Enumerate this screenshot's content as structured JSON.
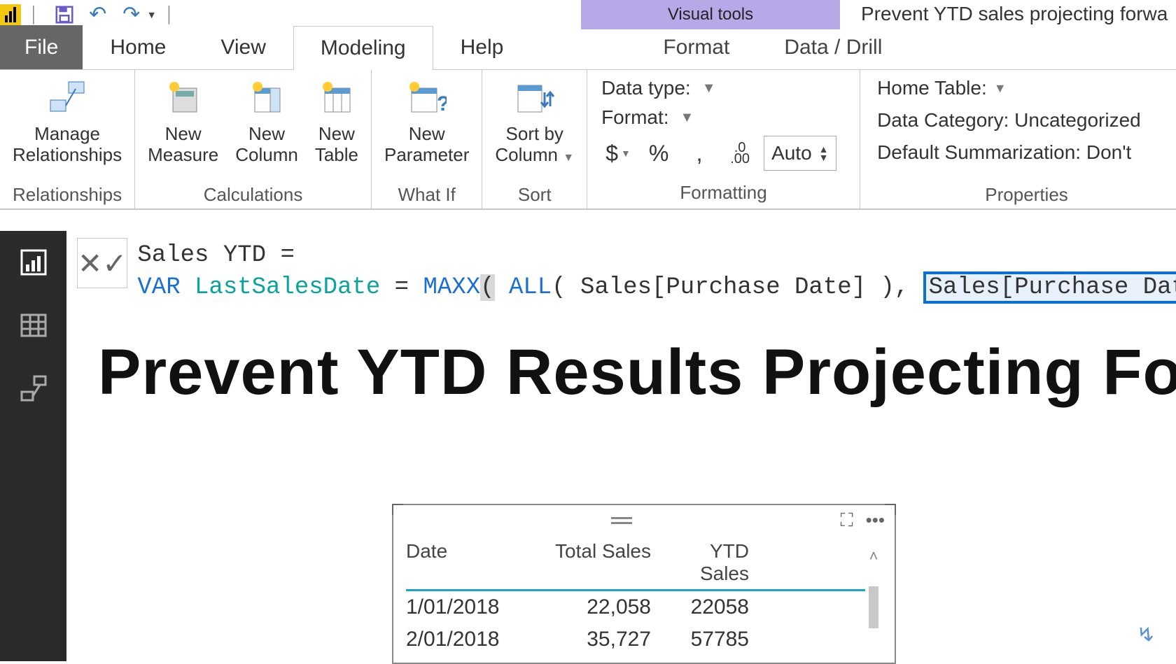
{
  "qat": {
    "visual_tools": "Visual tools",
    "window_title": "Prevent YTD sales projecting forwa"
  },
  "tabs": {
    "file": "File",
    "home": "Home",
    "view": "View",
    "modeling": "Modeling",
    "help": "Help",
    "format": "Format",
    "data_drill": "Data / Drill"
  },
  "ribbon": {
    "relationships": {
      "manage": "Manage\nRelationships",
      "group": "Relationships"
    },
    "calculations": {
      "measure": "New\nMeasure",
      "column": "New\nColumn",
      "table": "New\nTable",
      "group": "Calculations"
    },
    "whatif": {
      "parameter": "New\nParameter",
      "group": "What If"
    },
    "sort": {
      "sortby": "Sort by\nColumn",
      "group": "Sort"
    },
    "formatting": {
      "datatype": "Data type:",
      "format": "Format:",
      "dollar": "$",
      "percent": "%",
      "comma": ",",
      "decimals_icon": ".00",
      "auto": "Auto",
      "group": "Formatting"
    },
    "properties": {
      "home_table": "Home Table:",
      "category": "Data Category: Uncategorized",
      "summarization": "Default Summarization: Don't",
      "group": "Properties"
    }
  },
  "formula": {
    "line1": "Sales YTD =",
    "var_kw": "VAR",
    "var_name": "LastSalesDate",
    "eq": " = ",
    "maxx": "MAXX",
    "all": "ALL",
    "arg1": " Sales[Purchase Date] ",
    "arg2_sel": "Sales[Purchase Date] "
  },
  "canvas": {
    "title": "Prevent YTD Results Projecting Forw"
  },
  "table": {
    "columns": [
      "Date",
      "Total Sales",
      "YTD Sales"
    ],
    "rows": [
      {
        "date": "1/01/2018",
        "total": "22,058",
        "ytd": "22058"
      },
      {
        "date": "2/01/2018",
        "total": "35,727",
        "ytd": "57785"
      }
    ]
  }
}
